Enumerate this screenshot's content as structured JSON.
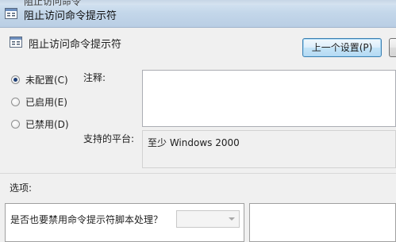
{
  "window": {
    "title": "阻止访问命令提示符",
    "ghost_title": "阻止访问命令"
  },
  "header": {
    "policy_name": "阻止访问命令提示符"
  },
  "buttons": {
    "prev_setting": "上一个设置(P)"
  },
  "state_options": [
    {
      "label": "未配置(C)",
      "checked": true
    },
    {
      "label": "已启用(E)",
      "checked": false
    },
    {
      "label": "已禁用(D)",
      "checked": false
    }
  ],
  "comment": {
    "label": "注释:",
    "value": ""
  },
  "supported_on": {
    "label": "支持的平台:",
    "value": "至少 Windows 2000"
  },
  "options": {
    "label": "选项:",
    "question": "是否也要禁用命令提示符脚本处理？",
    "selected_value": ""
  },
  "colors": {
    "accent": "#3c7fb1",
    "radio_dot": "#1e3f76",
    "client_bg": "#f0f0f0"
  }
}
